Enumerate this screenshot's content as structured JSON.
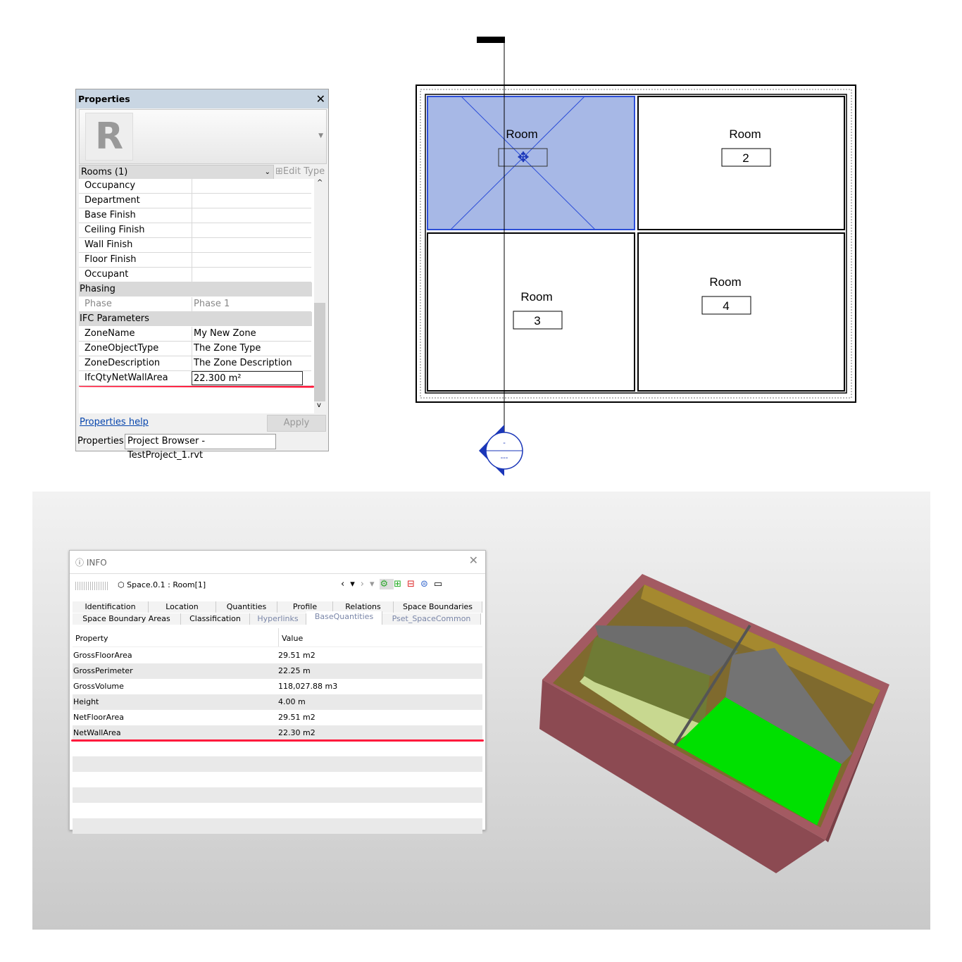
{
  "revit": {
    "title": "Properties",
    "type_selector": "Rooms (1)",
    "edit_type": "Edit Type",
    "rows": [
      {
        "k": "Occupancy",
        "v": ""
      },
      {
        "k": "Department",
        "v": ""
      },
      {
        "k": "Base Finish",
        "v": ""
      },
      {
        "k": "Ceiling Finish",
        "v": ""
      },
      {
        "k": "Wall Finish",
        "v": ""
      },
      {
        "k": "Floor Finish",
        "v": ""
      },
      {
        "k": "Occupant",
        "v": ""
      }
    ],
    "phasing_label": "Phasing",
    "phase": {
      "k": "Phase",
      "v": "Phase 1"
    },
    "ifc_label": "IFC Parameters",
    "ifc_rows": [
      {
        "k": "ZoneName",
        "v": "My New Zone"
      },
      {
        "k": "ZoneObjectType",
        "v": "The Zone Type"
      },
      {
        "k": "ZoneDescription",
        "v": "The Zone Description"
      },
      {
        "k": "IfcQtyNetWallArea",
        "v": "22.300 m²"
      }
    ],
    "help": "Properties help",
    "apply": "Apply",
    "tabs": [
      "Properties",
      "Project Browser - TestProject_1.rvt"
    ]
  },
  "plan": {
    "rooms": [
      {
        "label": "Room",
        "num": ""
      },
      {
        "label": "Room",
        "num": "2"
      },
      {
        "label": "Room",
        "num": "3"
      },
      {
        "label": "Room",
        "num": "4"
      }
    ],
    "section_top": "-",
    "section_bottom": "---",
    "selected_color": "#a7b8e6"
  },
  "info": {
    "title": "INFO",
    "object": "Space.0.1 : Room[1]",
    "tabs_row1": [
      "Identification",
      "Location",
      "Quantities",
      "Profile",
      "Relations",
      "Space Boundaries"
    ],
    "tabs_row2": [
      "Space Boundary Areas",
      "Classification",
      "Hyperlinks",
      "BaseQuantities",
      "Pset_SpaceCommon"
    ],
    "active_tab": "BaseQuantities",
    "col_property": "Property",
    "col_value": "Value",
    "rows": [
      {
        "k": "GrossFloorArea",
        "v": "29.51 m2"
      },
      {
        "k": "GrossPerimeter",
        "v": "22.25 m"
      },
      {
        "k": "GrossVolume",
        "v": "118,027.88 m3"
      },
      {
        "k": "Height",
        "v": "4.00 m"
      },
      {
        "k": "NetFloorArea",
        "v": "29.51 m2"
      },
      {
        "k": "NetWallArea",
        "v": "22.30 m2"
      }
    ]
  },
  "colors": {
    "highlight": "#ff1a3c",
    "link": "#0645ad",
    "space_green": "#00e000",
    "wall": "#8c4a52"
  }
}
